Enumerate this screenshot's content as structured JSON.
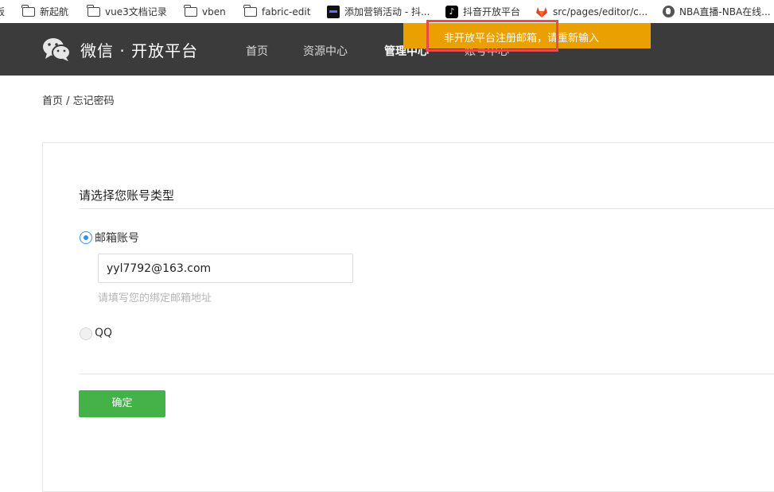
{
  "bookmarks": [
    {
      "label": "板",
      "icon": "none"
    },
    {
      "label": "新起航",
      "icon": "folder-icon"
    },
    {
      "label": "vue3文档记录",
      "icon": "folder-icon"
    },
    {
      "label": "vben",
      "icon": "folder-icon"
    },
    {
      "label": "fabric-edit",
      "icon": "folder-icon"
    },
    {
      "label": "添加营销活动 - 抖...",
      "icon": "dark-favicon"
    },
    {
      "label": "抖音开放平台",
      "icon": "tiktok-icon"
    },
    {
      "label": "src/pages/editor/c...",
      "icon": "gitlab-icon"
    },
    {
      "label": "NBA直播-NBA在线...",
      "icon": "globe-icon"
    }
  ],
  "header": {
    "logo_text": "微信 · 开放平台",
    "nav": [
      "首页",
      "资源中心",
      "管理中心",
      "账号中心"
    ],
    "active_nav": "管理中心"
  },
  "toast": {
    "message": "非开放平台注册邮箱，请重新输入"
  },
  "breadcrumb": "首页 / 忘记密码",
  "form": {
    "title": "请选择您账号类型",
    "option_email": "邮箱账号",
    "email_value": "yyl7792@163.com",
    "email_hint": "请填写您的绑定邮箱地址",
    "option_qq": "QQ",
    "selected": "邮箱账号",
    "submit_label": "确定"
  },
  "colors": {
    "header_bg": "#3b3b3b",
    "toast_bg": "#e9a000",
    "highlight_border": "#ea4a4a",
    "button_green": "#44b149",
    "radio_blue": "#3a8ee6"
  }
}
